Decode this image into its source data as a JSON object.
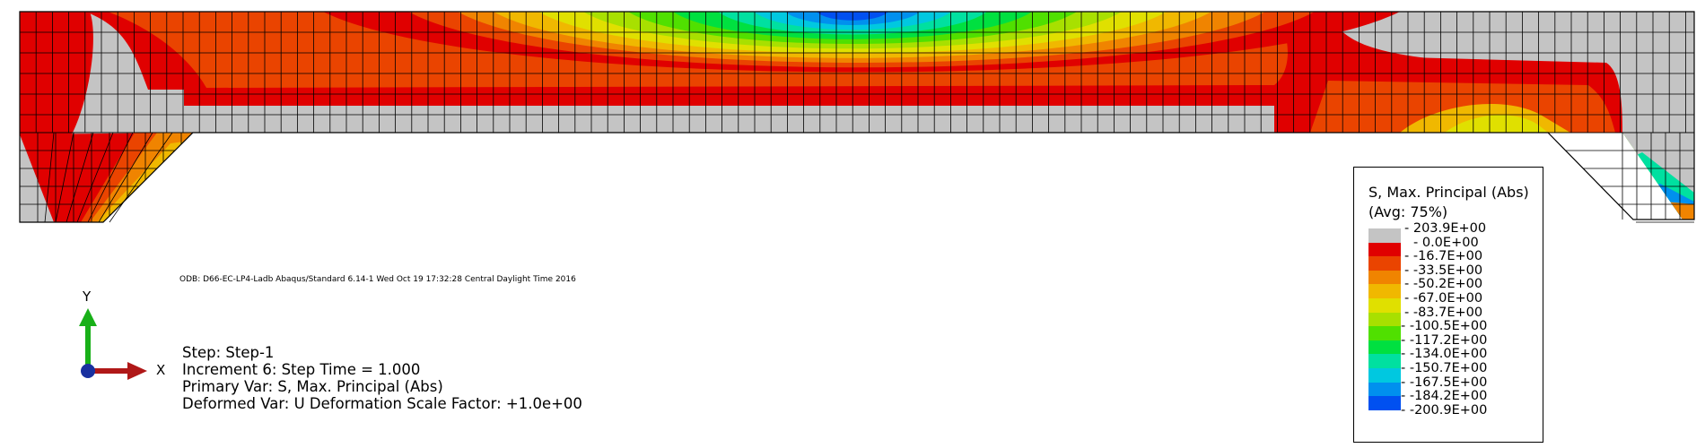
{
  "legend": {
    "title_line1": "S, Max. Principal (Abs)",
    "title_line2": "(Avg: 75%)",
    "entries": [
      {
        "value": "203.9E+00",
        "color": "#c4c4c4"
      },
      {
        "value": "0.0E+00",
        "color": "#e00000"
      },
      {
        "value": "-16.7E+00",
        "color": "#ea4400"
      },
      {
        "value": "-33.5E+00",
        "color": "#f08400"
      },
      {
        "value": "-50.2E+00",
        "color": "#f0b800"
      },
      {
        "value": "-67.0E+00",
        "color": "#e0e000"
      },
      {
        "value": "-83.7E+00",
        "color": "#a8e000"
      },
      {
        "value": "-100.5E+00",
        "color": "#50e000"
      },
      {
        "value": "-117.2E+00",
        "color": "#00e040"
      },
      {
        "value": "-134.0E+00",
        "color": "#00e0a0"
      },
      {
        "value": "-150.7E+00",
        "color": "#00c8e0"
      },
      {
        "value": "-167.5E+00",
        "color": "#0090ee"
      },
      {
        "value": "-184.2E+00",
        "color": "#0050f0"
      },
      {
        "value": "-200.9E+00",
        "color": "#0000d0"
      }
    ]
  },
  "odb_line": "ODB: D66-EC-LP4-Ladb    Abaqus/Standard 6.14-1    Wed Oct 19 17:32:28 Central Daylight Time 2016",
  "step_info": {
    "line1": "Step: Step-1",
    "line2": "Increment      6: Step Time =    1.000",
    "line3": "Primary Var: S, Max. Principal (Abs)",
    "line4": "Deformed Var: U   Deformation Scale Factor: +1.0e+00"
  },
  "triad": {
    "y_label": "Y",
    "x_label": "X",
    "x_color": "#b01818",
    "y_color": "#18b018",
    "origin_color": "#1830a0"
  },
  "model": {
    "background_color": "#c4c4c4",
    "mesh_color": "#000000"
  }
}
